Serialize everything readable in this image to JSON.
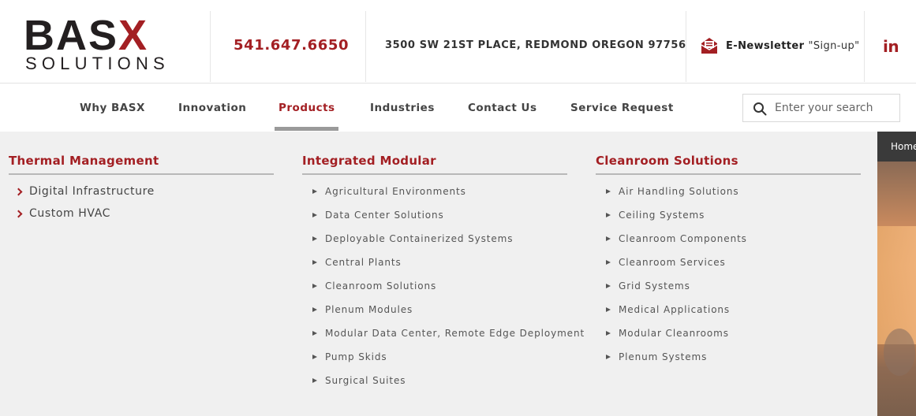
{
  "header": {
    "logo_main": "BAS",
    "logo_x": "X",
    "logo_sub": "SOLUTIONS",
    "phone": "541.647.6650",
    "address": "3500 SW 21ST PLACE, REDMOND OREGON 97756",
    "newsletter_label": "E-Newsletter",
    "newsletter_signup": "\"Sign-up\"",
    "linkedin": "in"
  },
  "nav": {
    "items": [
      {
        "label": "Why BASX"
      },
      {
        "label": "Innovation"
      },
      {
        "label": "Products"
      },
      {
        "label": "Industries"
      },
      {
        "label": "Contact Us"
      },
      {
        "label": "Service Request"
      }
    ],
    "active": "Products",
    "search_placeholder": "Enter your search"
  },
  "mega_menu": {
    "thermal": {
      "title": "Thermal Management",
      "links": [
        "Digital Infrastructure",
        "Custom HVAC"
      ]
    },
    "integrated": {
      "title": "Integrated Modular",
      "links": [
        "Agricultural Environments",
        "Data Center Solutions",
        "Deployable Containerized Systems",
        "Central Plants",
        "Cleanroom Solutions",
        "Plenum Modules",
        "Modular Data Center, Remote Edge Deployment",
        "Pump Skids",
        "Surgical Suites"
      ]
    },
    "cleanroom": {
      "title": "Cleanroom Solutions",
      "links": [
        "Air Handling Solutions",
        "Ceiling Systems",
        "Cleanroom Components",
        "Cleanroom Services",
        "Grid Systems",
        "Medical Applications",
        "Modular Cleanrooms",
        "Plenum Systems"
      ]
    }
  },
  "hero": {
    "breadcrumb_home": "Home"
  },
  "colors": {
    "brand_red": "#a31f23",
    "text_dark": "#231f20",
    "menu_bg": "#f0f0f0"
  }
}
